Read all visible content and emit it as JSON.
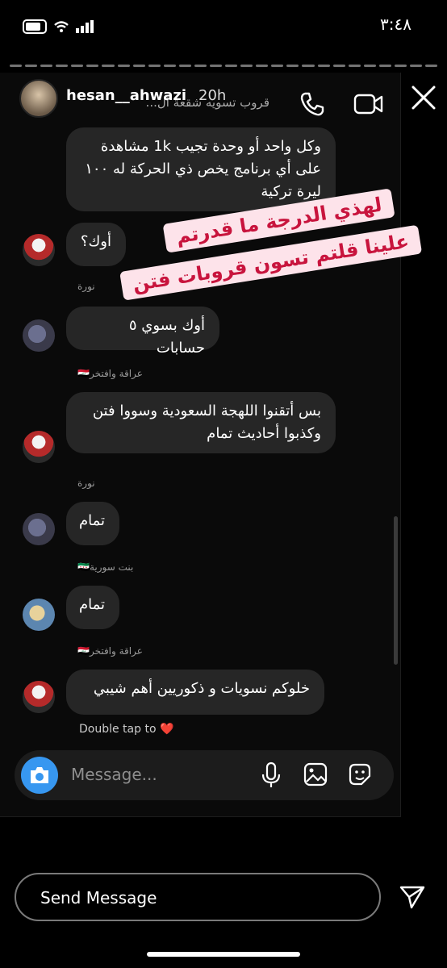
{
  "status_bar": {
    "time": "٣:٤٨"
  },
  "story": {
    "username": "hesan__ahwazi",
    "time": "20h"
  },
  "chat": {
    "group_name": "قروب تسويه شقعة ال...",
    "messages": [
      {
        "text": "وكل واحد أو وحدة تجيب 1k مشاهدة على أي برنامج يخص ذي الحركة له ١٠٠ ليرة تركية"
      },
      {
        "text": "أوك؟"
      },
      {
        "sender": "نورة",
        "text": "أوك بسوي ٥ حسابات"
      },
      {
        "sender": "عراقة وافتخر🇮🇶",
        "text": "بس أتقنوا اللهجة السعودية وسووا فتن وكذبوا أحاديث تمام"
      },
      {
        "sender": "نورة",
        "text": "تمام"
      },
      {
        "sender": "بنت سورية🇸🇾",
        "text": "تمام"
      },
      {
        "sender": "عراقة وافتخر🇮🇶",
        "text": "خلوكم نسويات و ذكوريين أهم شيبي"
      }
    ],
    "double_tap_hint": "Double tap to ❤️",
    "composer_placeholder": "Message..."
  },
  "sticker": {
    "line1": "لهذي الدرجة ما قدرتم",
    "line2": "علينا قلتم تسون قروبات فتن"
  },
  "reply_bar": {
    "placeholder": "Send Message"
  },
  "colors": {
    "accent": "#3797f0",
    "bubble": "#262626",
    "sticker_bg": "#fde3ea",
    "sticker_text": "#c8143d"
  }
}
